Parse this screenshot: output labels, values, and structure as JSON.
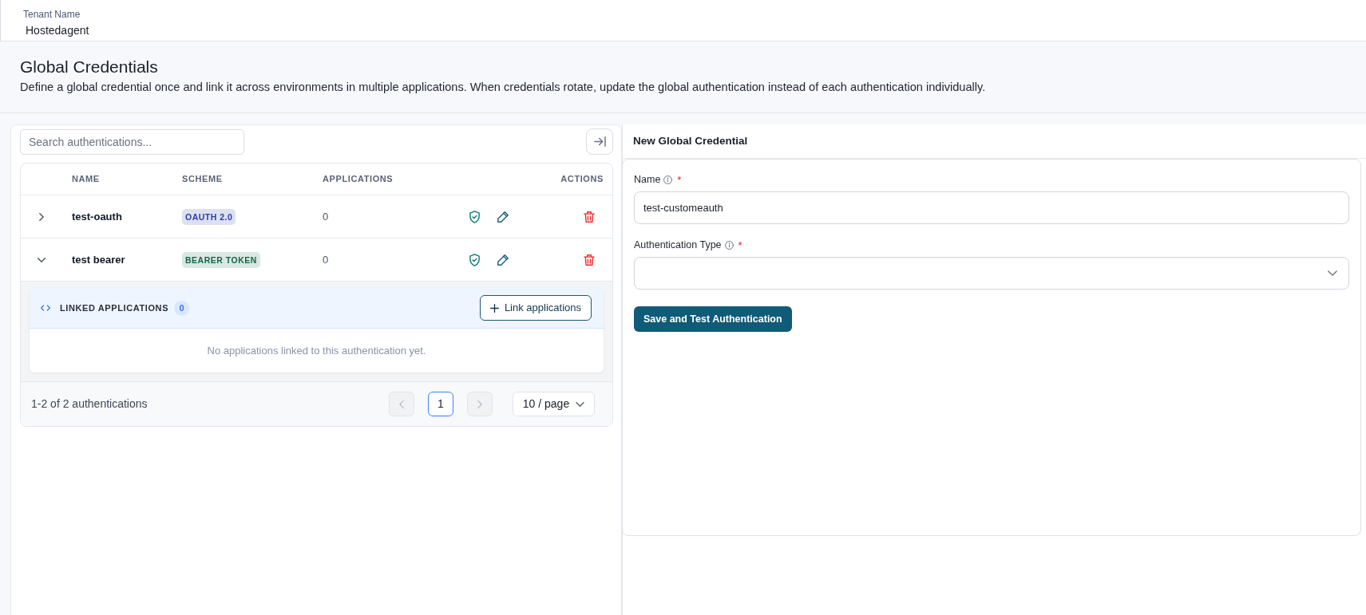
{
  "header": {
    "label": "Tenant Name",
    "value": "Hostedagent"
  },
  "page": {
    "title": "Global Credentials",
    "description": "Define a global credential once and link it across environments in multiple applications. When credentials rotate, update the global authentication instead of each authentication individually."
  },
  "list_panel": {
    "search": {
      "placeholder": "Search authentications..."
    },
    "table": {
      "columns": [
        "NAME",
        "SCHEME",
        "APPLICATIONS",
        "ACTIONS"
      ],
      "rows": [
        {
          "name": "test-oauth",
          "scheme": {
            "label": "OAUTH 2.0",
            "color": "#2b3ea8"
          },
          "applications": "0",
          "expanded": false
        },
        {
          "name": "test bearer",
          "scheme": {
            "label": "BEARER TOKEN",
            "color": "#15674a"
          },
          "applications": "0",
          "expanded": true,
          "linked": {
            "title": "LINKED APPLICATIONS",
            "count": "0",
            "button": "Link applications",
            "empty_text": "No applications linked to this authentication yet."
          }
        }
      ]
    },
    "pagination": {
      "summary": "1-2 of 2 authentications",
      "prev_disabled": true,
      "pages": [
        {
          "label": "1",
          "selected": true
        }
      ],
      "next_disabled": true,
      "page_size": "10 / page"
    }
  },
  "form_panel": {
    "title": "New Global Credential",
    "fields": [
      {
        "kind": "text",
        "label": "Name",
        "required_mark": "*",
        "value": "test-customeauth"
      },
      {
        "kind": "select",
        "label": "Authentication Type",
        "required_mark": "*"
      }
    ],
    "submit": "Save and Test Authentication"
  }
}
